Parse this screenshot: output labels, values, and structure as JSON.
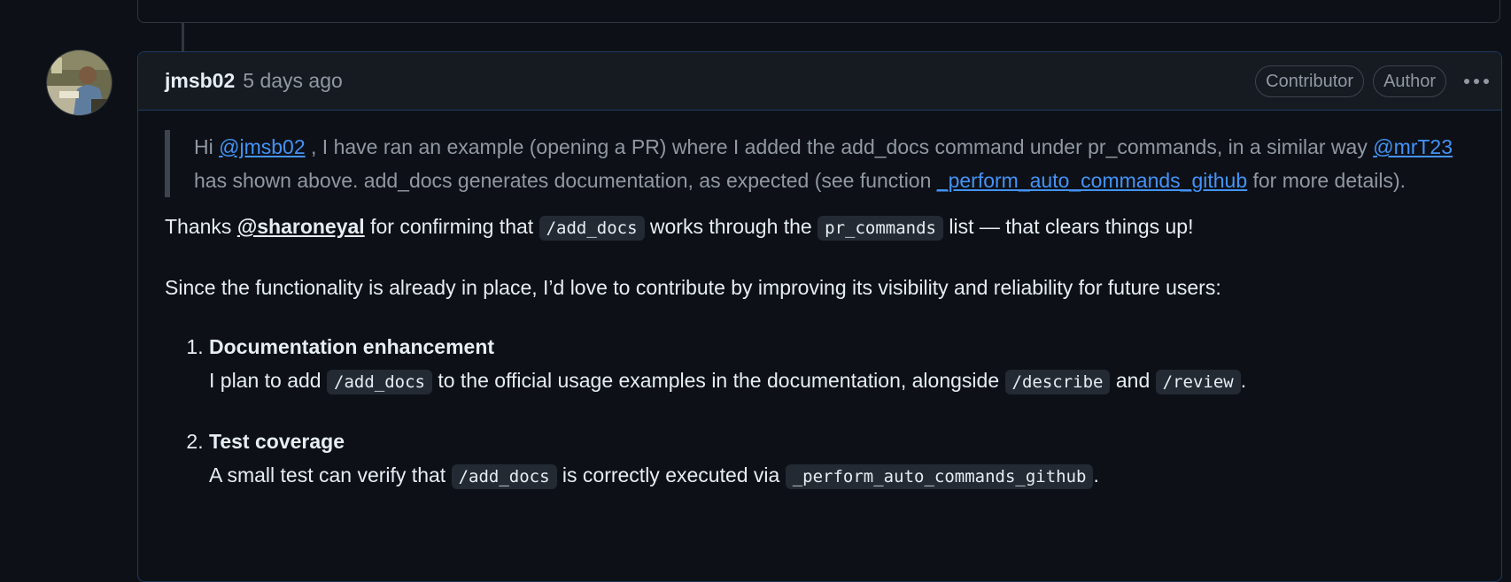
{
  "comment": {
    "author": "jmsb02",
    "time": "5 days ago",
    "badges": [
      "Contributor",
      "Author"
    ],
    "menu_icon": "kebab-horizontal-icon"
  },
  "quote": {
    "part1": "Hi ",
    "mention1": "@jmsb02",
    "part2": " , I have ran an example (opening a PR) where I added the add_docs command under pr_commands, in a similar way ",
    "mention2": "@mrT23",
    "part3": " has shown above. add_docs generates documentation, as expected (see function ",
    "link": "_perform_auto_commands_github",
    "part4": " for more details)."
  },
  "para1": {
    "t1": "Thanks ",
    "user": "@sharoneyal",
    "t2": " for confirming that ",
    "code1": "/add_docs",
    "t3": " works through the ",
    "code2": "pr_commands",
    "t4": " list — that clears things up!"
  },
  "para2": "Since the functionality is already in place, I’d love to contribute by improving its visibility and reliability for future users:",
  "list": [
    {
      "title": "Documentation enhancement",
      "t1": "I plan to add ",
      "code1": "/add_docs",
      "t2": " to the official usage examples in the documentation, alongside ",
      "code2": "/describe",
      "t3": " and ",
      "code3": "/review",
      "t4": "."
    },
    {
      "title": "Test coverage",
      "t1": "A small test can verify that ",
      "code1": "/add_docs",
      "t2": " is correctly executed via ",
      "code2": "_perform_auto_commands_github",
      "t3": "."
    }
  ]
}
